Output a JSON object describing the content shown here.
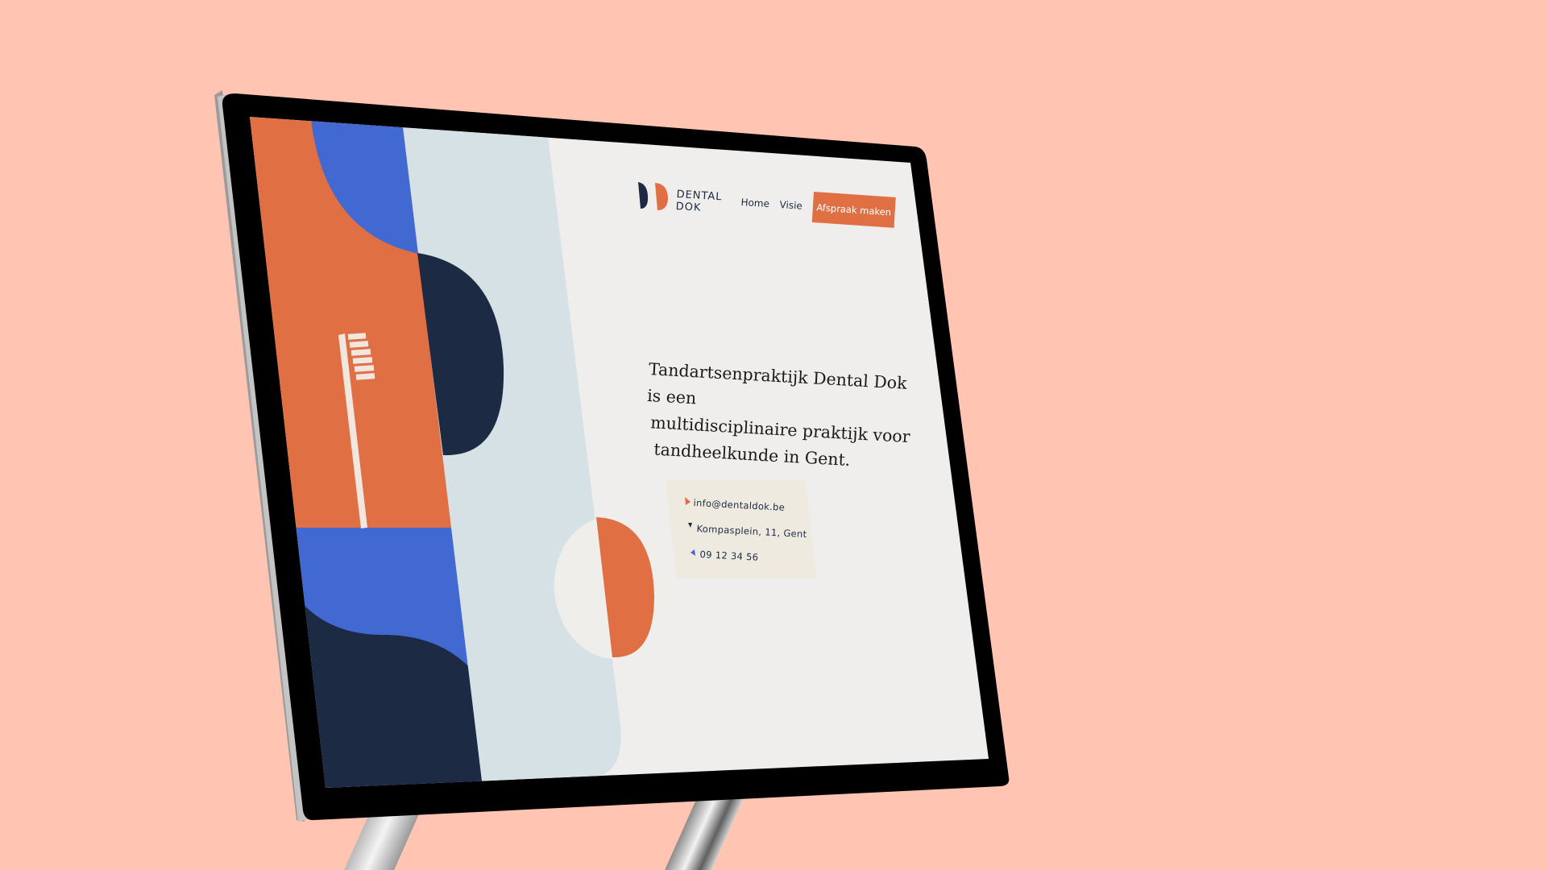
{
  "colors": {
    "background": "#FFC4B2",
    "orange": "#E07043",
    "blue": "#4169D1",
    "navy": "#1D2A44",
    "pale_blue": "#D6E1E6",
    "page_bg": "#EFEEEC",
    "contact_card": "#EEEAE0",
    "bezel": "#000000"
  },
  "header": {
    "logo_line1": "DENTAL",
    "logo_line2": "DOK",
    "nav": [
      {
        "label": "Home"
      },
      {
        "label": "Visie"
      }
    ],
    "cta_label": "Afspraak maken"
  },
  "hero": {
    "headline_lines": [
      "Tandartsenpraktijk Dental Dok is een",
      "multidisciplinaire praktijk voor",
      "tandheelkunde in Gent."
    ]
  },
  "contact": {
    "email": "info@dentaldok.be",
    "address": "Kompasplein, 11, Gent",
    "phone": "09 12 34 56"
  },
  "icons": {
    "logo": "dental-dok-logo-icon",
    "toothbrush": "toothbrush-icon",
    "email": "triangle-bullet-icon",
    "address": "triangle-bullet-icon",
    "phone": "triangle-bullet-icon"
  }
}
